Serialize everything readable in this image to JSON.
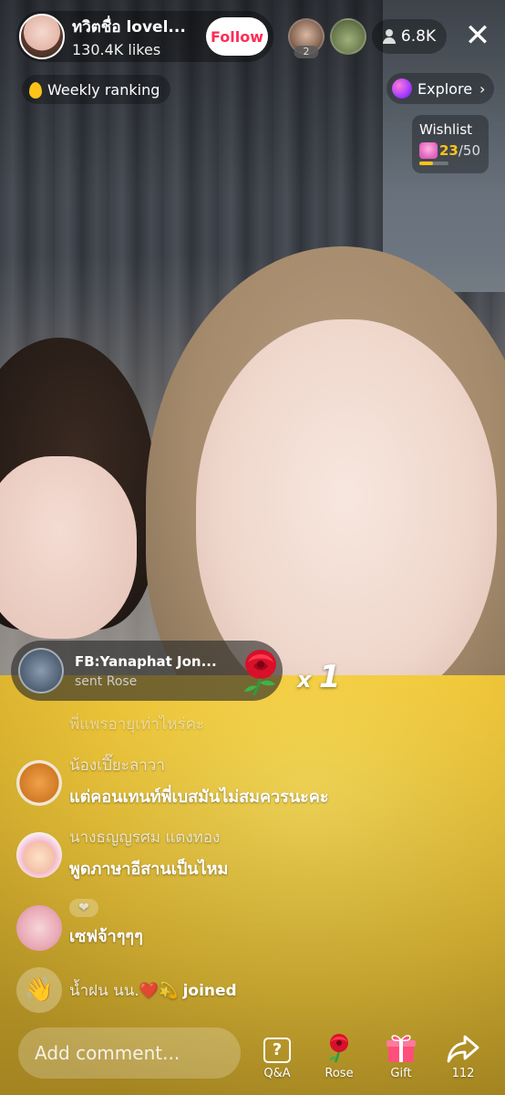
{
  "host": {
    "name": "ทวิตชื่อ lovel...",
    "likes": "130.4K likes",
    "follow_label": "Follow"
  },
  "viewers": {
    "top_rank_label": "2",
    "count": "6.8K"
  },
  "close_label": "✕",
  "weekly_ranking": {
    "label": "Weekly ranking"
  },
  "explore": {
    "label": "Explore",
    "chevron": "›"
  },
  "wishlist": {
    "title": "Wishlist",
    "count": "23",
    "total": "/50",
    "progress_fraction": 0.46
  },
  "gift_banner": {
    "sender": "FB:Yanaphat Jon...",
    "action": "sent Rose",
    "multiplier_prefix": "x",
    "multiplier_value": "1"
  },
  "comments": [
    {
      "user": "พี่แพรอายุเท่าไหร่คะ",
      "message": ""
    },
    {
      "user": "น้องเปี๊ยะลาวา",
      "message": "แต่คอนเทนท์พี่เบสมันไม่สมควรนะคะ"
    },
    {
      "user": "นางธญญรศม แตงทอง",
      "message": "พูดภาษาอีสานเป็นไหม"
    },
    {
      "user": "",
      "message": "เซฟจ้าๆๆๆ",
      "badge": "❤"
    }
  ],
  "joined": {
    "user": "น้ำฝน นน.",
    "emoji": "❤️💫",
    "label": "joined",
    "wave": "👋"
  },
  "bottom_bar": {
    "comment_placeholder": "Add comment...",
    "qa_label": "Q&A",
    "qa_glyph": "?",
    "rose_label": "Rose",
    "gift_label": "Gift",
    "share_count": "112"
  },
  "colors": {
    "follow_red": "#fe2c55",
    "gold": "#ffc21a",
    "shirt_yellow": "#f2c93a"
  },
  "icons": [
    "flame-icon",
    "planet-icon",
    "chevron-right-icon",
    "person-icon",
    "close-icon",
    "gift-mini-icon",
    "rose-icon",
    "wave-icon",
    "qa-icon",
    "gift-box-icon",
    "share-icon",
    "heart-badge-icon"
  ]
}
